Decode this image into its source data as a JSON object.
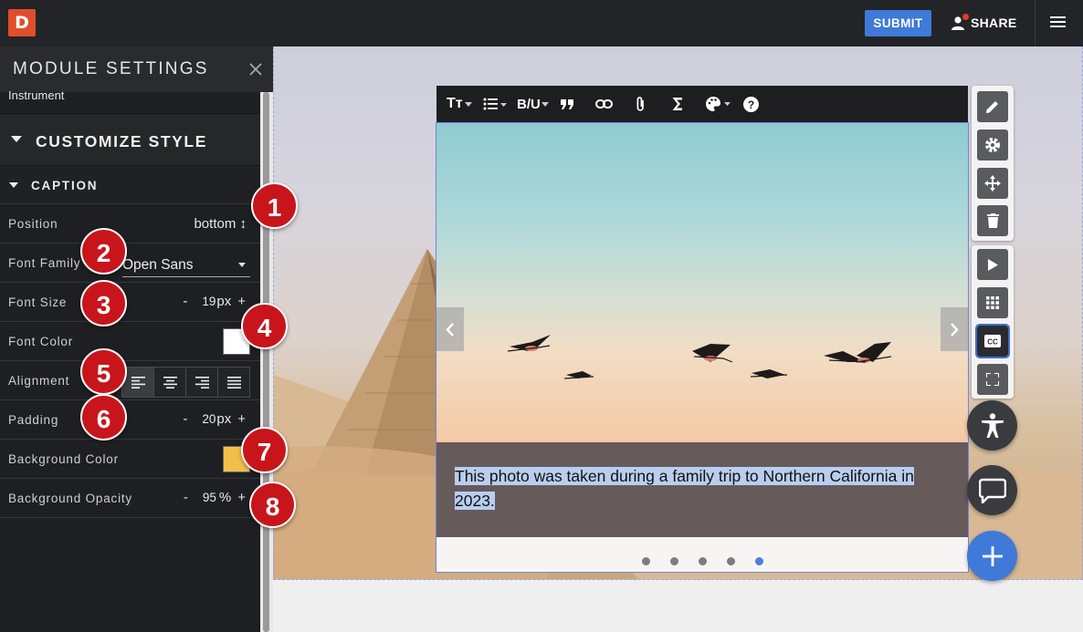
{
  "topbar": {
    "logo_letter": "D",
    "submit_label": "SUBMIT",
    "share_label": "SHARE"
  },
  "sidebar": {
    "title": "MODULE SETTINGS",
    "module_name": "Instrument",
    "section_title": "CUSTOMIZE STYLE",
    "subsection_title": "CAPTION",
    "rows": {
      "position": {
        "label": "Position",
        "value": "bottom ↕"
      },
      "font_family": {
        "label": "Font Family",
        "value": "Open Sans"
      },
      "font_size": {
        "label": "Font Size",
        "minus": "-",
        "value": "19",
        "unit": "px",
        "plus": "+"
      },
      "font_color": {
        "label": "Font Color",
        "color": "#ffffff"
      },
      "alignment": {
        "label": "Alignment",
        "options": [
          "left",
          "center",
          "right",
          "justify"
        ],
        "selected": "left"
      },
      "padding": {
        "label": "Padding",
        "minus": "-",
        "value": "20",
        "unit": "px",
        "plus": "+"
      },
      "background_color": {
        "label": "Background Color",
        "color": "#f2c04a"
      },
      "background_opacity": {
        "label": "Background Opacity",
        "minus": "-",
        "value": "95",
        "unit": "%",
        "plus": "+"
      }
    }
  },
  "badges": [
    "1",
    "2",
    "3",
    "4",
    "5",
    "6",
    "7",
    "8"
  ],
  "editor": {
    "toolbar_icons": [
      "text-size-icon",
      "list-icon",
      "bold-underline-icon",
      "quote-icon",
      "link-icon",
      "attachment-icon",
      "sigma-icon",
      "palette-icon",
      "help-icon"
    ],
    "toolbar_glyphs": {
      "text_size": "Tт",
      "bold_underline": "B/U"
    },
    "caption": "This photo was taken during a family trip to Northern California in 2023.",
    "slide_count": 5,
    "active_slide": 5
  },
  "side_tools": [
    "pencil-icon",
    "gear-icon",
    "move-icon",
    "trash-icon",
    "play-icon",
    "grid-icon",
    "closed-caption-icon",
    "fullscreen-icon"
  ],
  "colors": {
    "accent": "#3f7ad9",
    "badge": "#c8151b",
    "caption_bg": "#665a5b",
    "selection": "#b9ceef"
  }
}
